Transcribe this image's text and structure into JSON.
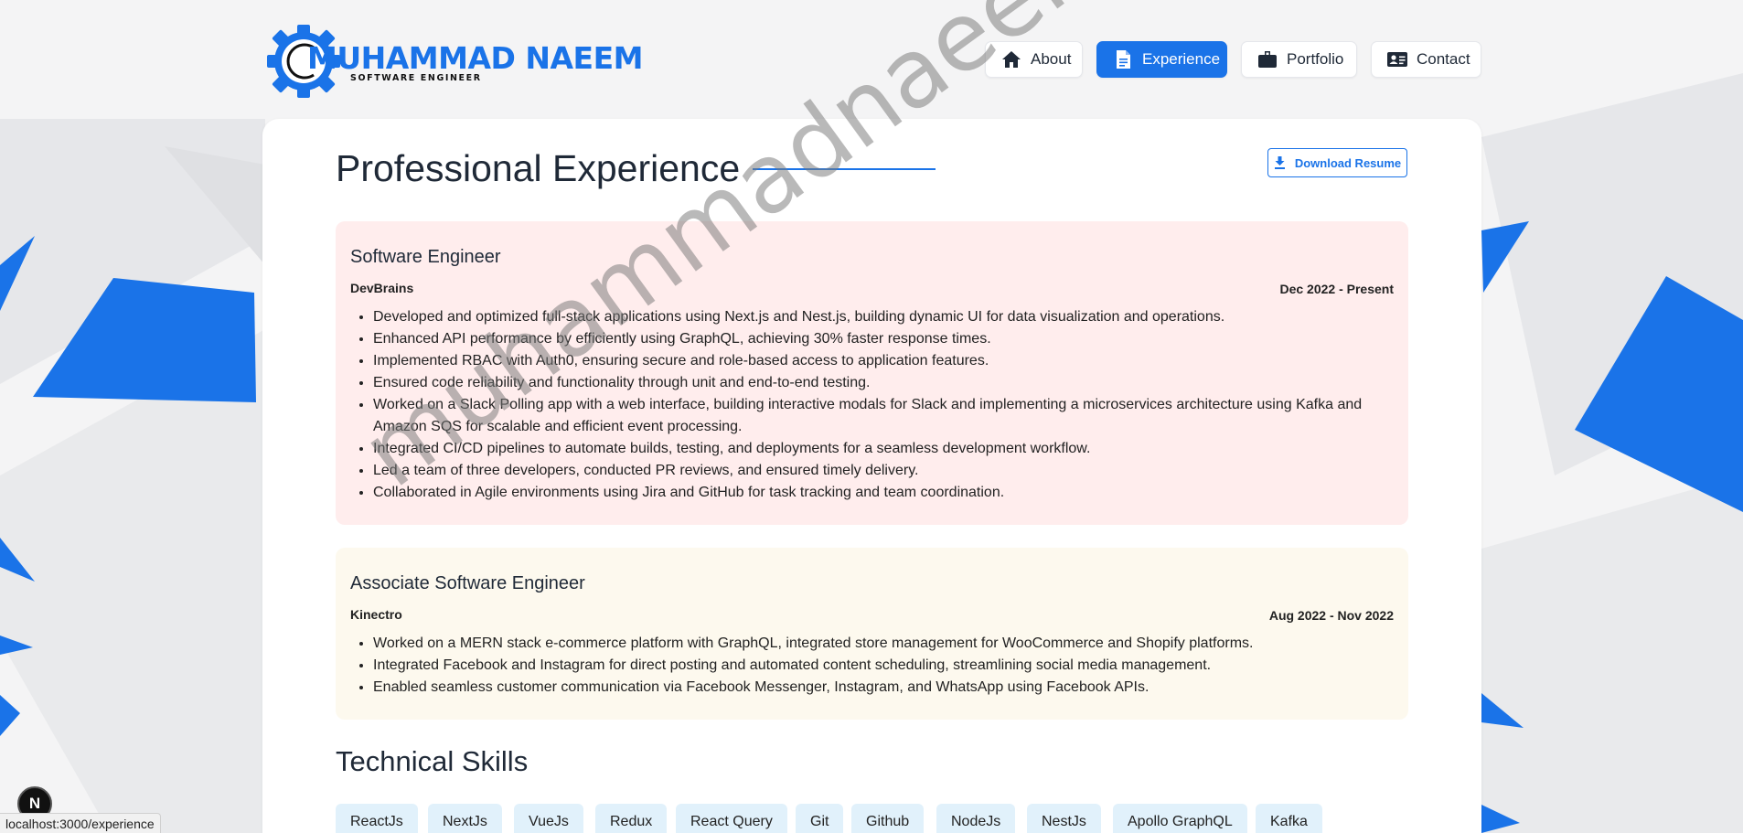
{
  "brand": {
    "name": "MUHAMMAD NAEEM",
    "subtitle": "SOFTWARE ENGINEER",
    "color": "#1a73e8"
  },
  "nav": {
    "items": [
      {
        "label": "About",
        "icon": "home-icon",
        "active": false
      },
      {
        "label": "Experience",
        "icon": "document-icon",
        "active": true
      },
      {
        "label": "Portfolio",
        "icon": "briefcase-icon",
        "active": false
      },
      {
        "label": "Contact",
        "icon": "contact-card-icon",
        "active": false
      }
    ]
  },
  "page": {
    "title": "Professional Experience",
    "download_label": "Download Resume"
  },
  "experience": [
    {
      "title": "Software Engineer",
      "company": "DevBrains",
      "dates": "Dec 2022 - Present",
      "background": "#ffeded",
      "bullets": [
        "Developed and optimized full-stack applications using Next.js and Nest.js, building dynamic UI for data visualization and operations.",
        "Enhanced API performance by efficiently using GraphQL, achieving 30% faster response times.",
        "Implemented RBAC with Auth0, ensuring secure and role-based access to application features.",
        "Ensured code reliability and functionality through unit and end-to-end testing.",
        "Worked on a Slack Polling app with a web interface, building interactive modals for Slack and implementing a microservices architecture using Kafka and Amazon SQS for scalable and efficient event processing.",
        "Integrated CI/CD pipelines to automate builds, testing, and deployments for a seamless development workflow.",
        "Led a team of three developers, conducted PR reviews, and ensured timely delivery.",
        "Collaborated in Agile environments using Jira and GitHub for task tracking and team coordination."
      ]
    },
    {
      "title": "Associate Software Engineer",
      "company": "Kinectro",
      "dates": "Aug 2022 - Nov 2022",
      "background": "#fdf9ee",
      "bullets": [
        "Worked on a MERN stack e-commerce platform with GraphQL, integrated store management for WooCommerce and Shopify platforms.",
        "Integrated Facebook and Instagram for direct posting and automated content scheduling, streamlining social media management.",
        "Enabled seamless customer communication via Facebook Messenger, Instagram, and WhatsApp using Facebook APIs."
      ]
    }
  ],
  "skills": {
    "title": "Technical Skills",
    "items": [
      "ReactJs",
      "NextJs",
      "VueJs",
      "Redux",
      "React Query",
      "Git",
      "Github",
      "NodeJs",
      "NestJs",
      "Apollo GraphQL",
      "Kafka"
    ]
  },
  "watermark": "muhammadnaeem.me",
  "dev_badge": "N",
  "status_url": "localhost:3000/experience"
}
